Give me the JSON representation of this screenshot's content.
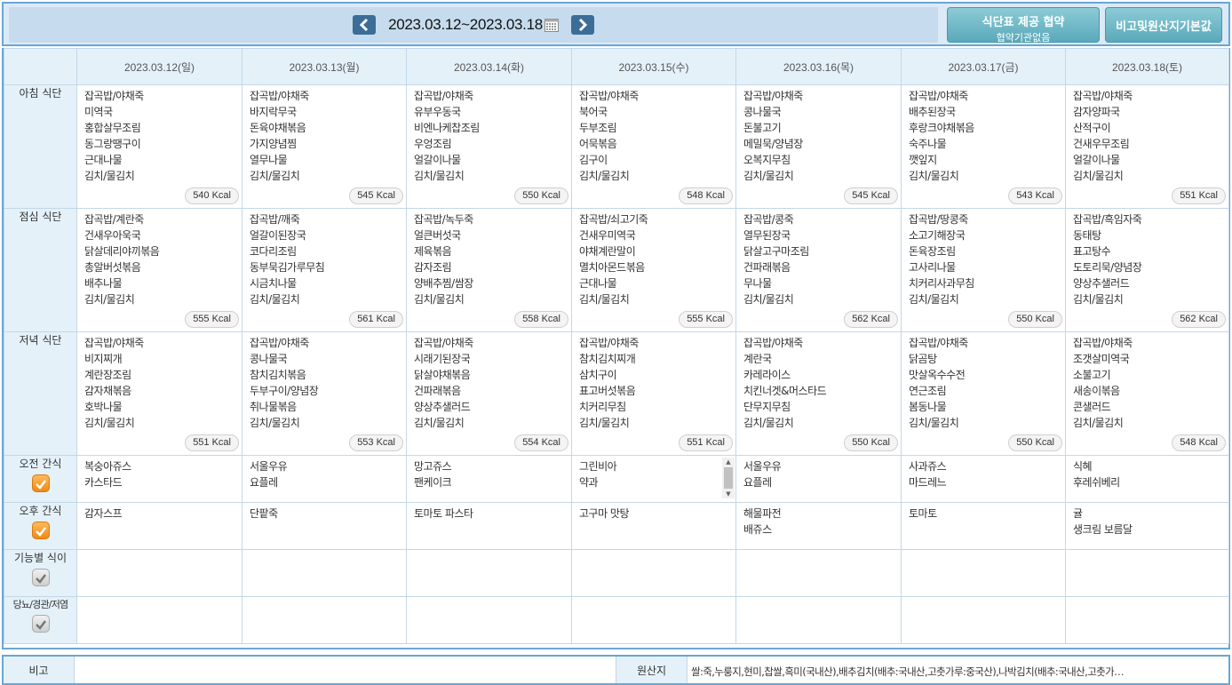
{
  "header": {
    "date_range": "2023.03.12~2023.03.18",
    "cafe_button": {
      "line1": "식단표 제공 협약",
      "line2": "협약기관없음"
    },
    "origin_button": "비고및원산지기본값"
  },
  "days": [
    {
      "label": "2023.03.12(일)",
      "color": "#d0272f"
    },
    {
      "label": "2023.03.13(월)"
    },
    {
      "label": "2023.03.14(화)"
    },
    {
      "label": "2023.03.15(수)"
    },
    {
      "label": "2023.03.16(목)"
    },
    {
      "label": "2023.03.17(금)"
    },
    {
      "label": "2023.03.18(토)",
      "color": "#2a5ec4"
    }
  ],
  "row_labels": {
    "breakfast": "아침 식단",
    "lunch": "점심 식단",
    "dinner": "저녁 식단",
    "am_snack": "오전 간식",
    "pm_snack": "오후 간식",
    "functional": "기능별 식이",
    "diabetic": "당뇨/경관/저염"
  },
  "breakfast": [
    {
      "items": [
        "잡곡밥/야채죽",
        "미역국",
        "홍합살무조림",
        "동그랑땡구이",
        "근대나물",
        "김치/물김치"
      ],
      "kcal": "540 Kcal"
    },
    {
      "items": [
        "잡곡밥/야채죽",
        "바지락무국",
        "돈육야채볶음",
        "가지양념찜",
        "열무나물",
        "김치/물김치"
      ],
      "kcal": "545 Kcal"
    },
    {
      "items": [
        "잡곡밥/야채죽",
        "유부우동국",
        "비엔나케찹조림",
        "우엉조림",
        "얼갈이나물",
        "김치/물김치"
      ],
      "kcal": "550 Kcal"
    },
    {
      "items": [
        "잡곡밥/야채죽",
        "북어국",
        "두부조림",
        "어묵볶음",
        "김구이",
        "김치/물김치"
      ],
      "kcal": "548 Kcal"
    },
    {
      "items": [
        "잡곡밥/야채죽",
        "콩나물국",
        "돈불고기",
        "메밀묵/양념장",
        "오복지무침",
        "김치/물김치"
      ],
      "kcal": "545 Kcal"
    },
    {
      "items": [
        "잡곡밥/야채죽",
        "배추된장국",
        "후랑크야채볶음",
        "숙주나물",
        "깻잎지",
        "김치/물김치"
      ],
      "kcal": "543 Kcal"
    },
    {
      "items": [
        "잡곡밥/야채죽",
        "감자양파국",
        "산적구이",
        "건새우무조림",
        "얼갈이나물",
        "김치/물김치"
      ],
      "kcal": "551 Kcal"
    }
  ],
  "lunch": [
    {
      "items": [
        "잡곡밥/계란죽",
        "건새우아욱국",
        "닭살데리야끼볶음",
        "총알버섯볶음",
        "배추나물",
        "김치/물김치"
      ],
      "kcal": "555 Kcal"
    },
    {
      "items": [
        "잡곡밥/깨죽",
        "얼갈이된장국",
        "코다리조림",
        "동부묵김가루무침",
        "시금치나물",
        "김치/물김치"
      ],
      "kcal": "561 Kcal"
    },
    {
      "items": [
        "잡곡밥/녹두죽",
        "얼큰버섯국",
        "제육볶음",
        "감자조림",
        "양배추찜/쌈장",
        "김치/물김치"
      ],
      "kcal": "558 Kcal"
    },
    {
      "items": [
        "잡곡밥/쇠고기죽",
        "건새우미역국",
        "야채계란말이",
        "멸치아몬드볶음",
        "근대나물",
        "김치/물김치"
      ],
      "kcal": "555 Kcal"
    },
    {
      "items": [
        "잡곡밥/콩죽",
        "열무된장국",
        "닭살고구마조림",
        "건파래볶음",
        "무나물",
        "김치/물김치"
      ],
      "kcal": "562 Kcal"
    },
    {
      "items": [
        "잡곡밥/땅콩죽",
        "소고기해장국",
        "돈육장조림",
        "고사리나물",
        "치커리사과무침",
        "김치/물김치"
      ],
      "kcal": "550 Kcal"
    },
    {
      "items": [
        "잡곡밥/흑임자죽",
        "동태탕",
        "표고탕수",
        "도토리묵/양념장",
        "양상추샐러드",
        "김치/물김치"
      ],
      "kcal": "562 Kcal"
    }
  ],
  "dinner": [
    {
      "items": [
        "잡곡밥/야채죽",
        "비지찌개",
        "계란장조림",
        "감자채볶음",
        "호박나물",
        "김치/물김치"
      ],
      "kcal": "551 Kcal"
    },
    {
      "items": [
        "잡곡밥/야채죽",
        "콩나물국",
        "참치김치볶음",
        "두부구이/양념장",
        "취나물볶음",
        "김치/물김치"
      ],
      "kcal": "553 Kcal"
    },
    {
      "items": [
        "잡곡밥/야채죽",
        "시래기된장국",
        "닭살야채볶음",
        "건파래볶음",
        "양상추샐러드",
        "김치/물김치"
      ],
      "kcal": "554 Kcal"
    },
    {
      "items": [
        "잡곡밥/야채죽",
        "참치김치찌개",
        "삼치구이",
        "표고버섯볶음",
        "치커리무침",
        "김치/물김치"
      ],
      "kcal": "551 Kcal"
    },
    {
      "items": [
        "잡곡밥/야채죽",
        "계란국",
        "카레라이스",
        "치킨너겟&머스타드",
        "단무지무침",
        "김치/물김치"
      ],
      "kcal": "550 Kcal"
    },
    {
      "items": [
        "잡곡밥/야채죽",
        "닭곰탕",
        "맛살옥수수전",
        "연근조림",
        "봄동나물",
        "김치/물김치"
      ],
      "kcal": "550 Kcal"
    },
    {
      "items": [
        "잡곡밥/야채죽",
        "조갯살미역국",
        "소불고기",
        "새송이볶음",
        "콘샐러드",
        "김치/물김치"
      ],
      "kcal": "548 Kcal"
    }
  ],
  "am_snack": [
    [
      "복숭아쥬스",
      "카스타드"
    ],
    [
      "서울우유",
      "요플레"
    ],
    [
      "망고쥬스",
      "팬케이크"
    ],
    [
      "그린비아",
      "약과"
    ],
    [
      "서울우유",
      "요플레"
    ],
    [
      "사과쥬스",
      "마드레느"
    ],
    [
      "식혜",
      "후레쉬베리"
    ]
  ],
  "pm_snack": [
    [
      "감자스프"
    ],
    [
      "단팥죽"
    ],
    [
      "토마토 파스타"
    ],
    [
      "고구마 맛탕"
    ],
    [
      "해물파전",
      "배쥬스"
    ],
    [
      "토마토"
    ],
    [
      "귤",
      "생크림 보름달"
    ]
  ],
  "footer": {
    "bigo_label": "비고",
    "origin_label": "원산지",
    "origin_text": "쌀:죽,누룽지,현미,찹쌀,흑미(국내산),배추김치(배추:국내산,고춧가루:중국산),나박김치(배추:국내산,고춧가…"
  },
  "colors": {
    "border": "#6aa6d6",
    "header_bg": "#e4f1f9",
    "button": "#5aa9ba",
    "checkbox_on": "#f08a14"
  }
}
